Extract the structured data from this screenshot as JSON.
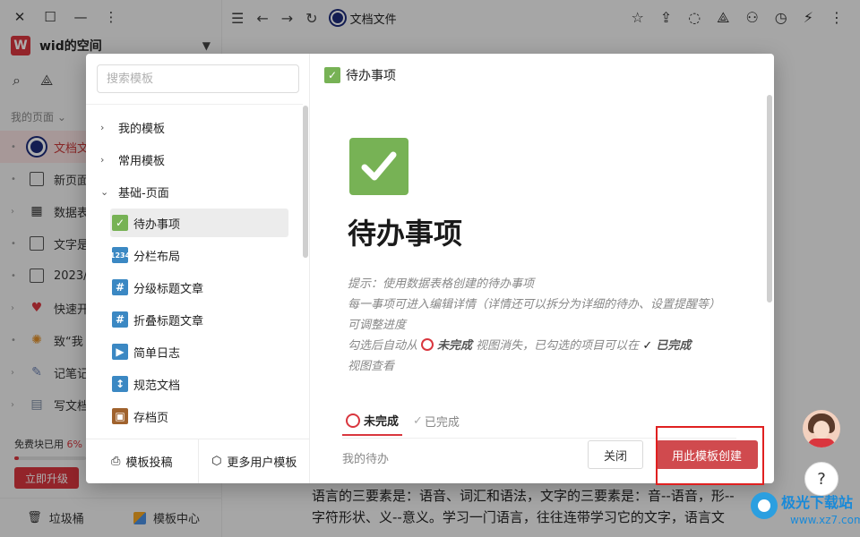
{
  "window": {
    "doc_tab": "文档文件"
  },
  "sidebar": {
    "space_logo": "W",
    "space_name": "wid的空间",
    "my_pages": "我的页面",
    "pages": [
      {
        "label": "文档文",
        "icon": "target-icon",
        "active": true
      },
      {
        "label": "新页面",
        "icon": "page-icon"
      },
      {
        "label": "数据表",
        "icon": "table-icon"
      },
      {
        "label": "文字是",
        "icon": "page-icon"
      },
      {
        "label": "2023/",
        "icon": "page-icon"
      },
      {
        "label": "快速开",
        "icon": "heart-icon"
      },
      {
        "label": "致“我",
        "icon": "party-icon"
      },
      {
        "label": "记笔记",
        "icon": "pen-icon"
      },
      {
        "label": "写文档",
        "icon": "doc-icon"
      }
    ],
    "quota_label": "免费块已用",
    "quota_value": "6%",
    "quota_fraction": 0.06,
    "upgrade": "立即升级",
    "trash": "垃圾桶",
    "template_center": "模板中心"
  },
  "modal": {
    "search_placeholder": "搜索模板",
    "groups": [
      "我的模板",
      "常用模板",
      "基础-页面"
    ],
    "templates": [
      {
        "label": "待办事项",
        "icon": "check-icon",
        "selected": true
      },
      {
        "label": "分栏布局",
        "icon": "numbers-icon"
      },
      {
        "label": "分级标题文章",
        "icon": "hash-icon"
      },
      {
        "label": "折叠标题文章",
        "icon": "hash-icon"
      },
      {
        "label": "简单日志",
        "icon": "play-icon"
      },
      {
        "label": "规范文档",
        "icon": "updown-icon"
      },
      {
        "label": "存档页",
        "icon": "box-icon"
      }
    ],
    "footer_submit": "模板投稿",
    "footer_more": "更多用户模板",
    "preview": {
      "header": "待办事项",
      "title": "待办事项",
      "hint_lines": [
        "提示：使用数据表格创建的待办事项",
        "每一事项可进入编辑详情（详情还可以拆分为详细的待办、设置提醒等）",
        "可调整进度"
      ],
      "hint_auto_prefix": "勾选后自动从",
      "hint_unfinished": "未完成",
      "hint_auto_middle": "视图消失，已勾选的项目可以在",
      "hint_done": "已完成",
      "hint_view": "视图查看",
      "tab_unfinished": "未完成",
      "tab_done": "已完成",
      "my_todo": "我的待办"
    },
    "close": "关闭",
    "create": "用此模板创建"
  },
  "background_doc": {
    "line1": "语言的三要素是：语音、词汇和语法，文字的三要素是：音--语音，形--",
    "line2": "字符形状、义--意义。学习一门语言，往往连带学习它的文字，语言文"
  },
  "help": "?",
  "watermark": {
    "name": "极光下载站",
    "url": "www.xz7.com"
  },
  "colors": {
    "accent": "#d9363e",
    "check_green": "#77b255",
    "highlight": "#e02020"
  }
}
